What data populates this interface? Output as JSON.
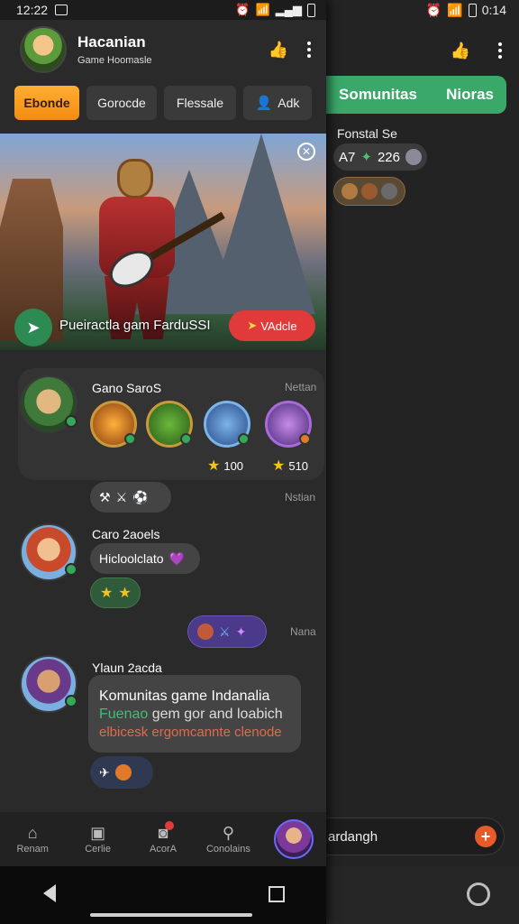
{
  "status_bar": {
    "time": "12:22",
    "right_time": "0:14"
  },
  "header": {
    "title": "Hacanian",
    "subtitle": "Game Hoomasle"
  },
  "tabs": [
    {
      "label": "Ebonde",
      "active": true
    },
    {
      "label": "Gorocde",
      "active": false
    },
    {
      "label": "Flessale",
      "active": false
    },
    {
      "label": "Adk",
      "active": false
    }
  ],
  "banner": {
    "caption": "Pueiractla gam FarduSSI",
    "cta": "VAdcle"
  },
  "feed": {
    "post1": {
      "name": "Gano SaroS",
      "time": "Nettan",
      "scores": [
        "100",
        "510"
      ]
    },
    "reactions1": {
      "time": "Nstian"
    },
    "post2": {
      "name": "Caro 2aoels",
      "message": "Hicloolclato"
    },
    "reactions2": {
      "time": "Nana"
    },
    "post3": {
      "name": "Ylaun 2acda",
      "line1": "Komunitas game Indanalia",
      "line2_highlight": "Fuenao",
      "line2_rest": " gem gor and loabich",
      "line3": "elbicesk ergomcannte clenode"
    }
  },
  "bottom_nav": [
    {
      "label": "Renam",
      "icon": "home-icon"
    },
    {
      "label": "Cerlie",
      "icon": "gamepad-icon"
    },
    {
      "label": "AcorA",
      "icon": "controller-icon"
    },
    {
      "label": "Conolains",
      "icon": "profile-icon"
    }
  ],
  "right_panel": {
    "tabs": [
      "Somunitas",
      "Nioras"
    ],
    "section_title": "Fonstal Se",
    "stat_a": "A7",
    "stat_b": "226",
    "input_text": "ardangh"
  },
  "colors": {
    "accent_orange": "#f48c12",
    "accent_green": "#3aa868",
    "cta_red": "#e03a3a"
  }
}
